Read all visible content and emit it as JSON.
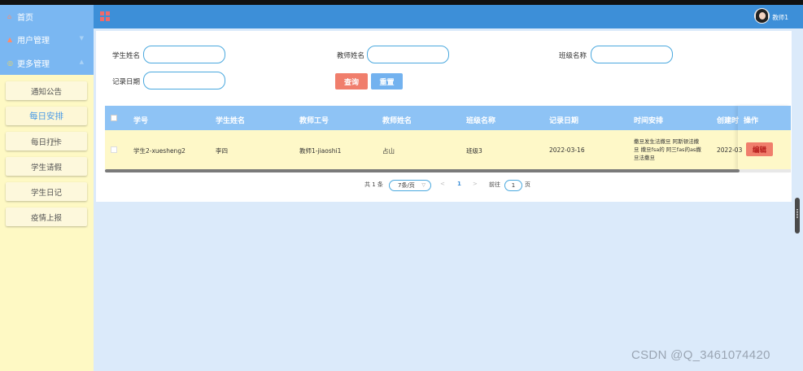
{
  "sidebar": {
    "nav": [
      {
        "label": "首页",
        "icon": "home-icon"
      },
      {
        "label": "用户管理",
        "icon": "user-icon"
      },
      {
        "label": "更多管理",
        "icon": "more-icon"
      }
    ],
    "subitems": [
      {
        "label": "通知公告"
      },
      {
        "label": "每日安排"
      },
      {
        "label": "每日打卡"
      },
      {
        "label": "学生请假"
      },
      {
        "label": "学生日记"
      },
      {
        "label": "疫情上报"
      }
    ]
  },
  "header": {
    "username": "教师1"
  },
  "search": {
    "student_name_label": "学生姓名",
    "teacher_name_label": "教师姓名",
    "class_name_label": "班级名称",
    "record_date_label": "记录日期",
    "query_label": "查询",
    "reset_label": "重置"
  },
  "table": {
    "columns": [
      "学号",
      "学生姓名",
      "教师工号",
      "教师姓名",
      "班级名称",
      "记录日期",
      "时间安排",
      "创建时",
      "操作"
    ],
    "rows": [
      {
        "student_id": "学生2-xuesheng2",
        "student_name": "李四",
        "teacher_id": "教师1-jiaoshi1",
        "teacher_name": "占山",
        "class_name": "班级3",
        "record_date": "2022-03-16",
        "schedule_line1": "撒旦发生法撒旦 阿斯顿法撒",
        "schedule_line2": "旦 撒旦fsa的 阿三fas的as撒",
        "schedule_line3": "旦法撒旦",
        "created": "2022-03",
        "edit_label": "编辑"
      }
    ]
  },
  "pager": {
    "total": "共 1 条",
    "page_size": "7条/页",
    "prev": "<",
    "current": "1",
    "next": ">",
    "goto_label": "前往",
    "goto_value": "1",
    "page_suffix": "页"
  },
  "watermark": "CSDN @Q_3461074420"
}
